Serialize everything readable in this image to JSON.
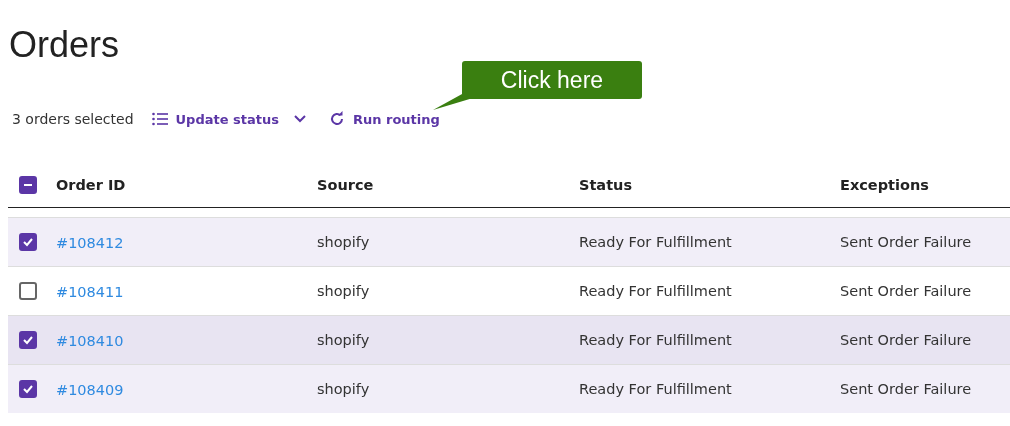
{
  "title": "Orders",
  "toolbar": {
    "selection_count": "3 orders selected",
    "update_status": "Update status",
    "run_routing": "Run routing"
  },
  "callout": {
    "text": "Click here"
  },
  "table": {
    "select_all": {
      "indeterminate": true
    },
    "columns": [
      "Order ID",
      "Source",
      "Status",
      "Exceptions"
    ],
    "rows": [
      {
        "checked": true,
        "hovered": false,
        "order_id": "#108412",
        "source": "shopify",
        "status": "Ready For Fulfillment",
        "exceptions": "Sent Order Failure"
      },
      {
        "checked": false,
        "hovered": false,
        "order_id": "#108411",
        "source": "shopify",
        "status": "Ready For Fulfillment",
        "exceptions": "Sent Order Failure"
      },
      {
        "checked": true,
        "hovered": true,
        "order_id": "#108410",
        "source": "shopify",
        "status": "Ready For Fulfillment",
        "exceptions": "Sent Order Failure"
      },
      {
        "checked": true,
        "hovered": false,
        "order_id": "#108409",
        "source": "shopify",
        "status": "Ready For Fulfillment",
        "exceptions": "Sent Order Failure"
      }
    ]
  }
}
